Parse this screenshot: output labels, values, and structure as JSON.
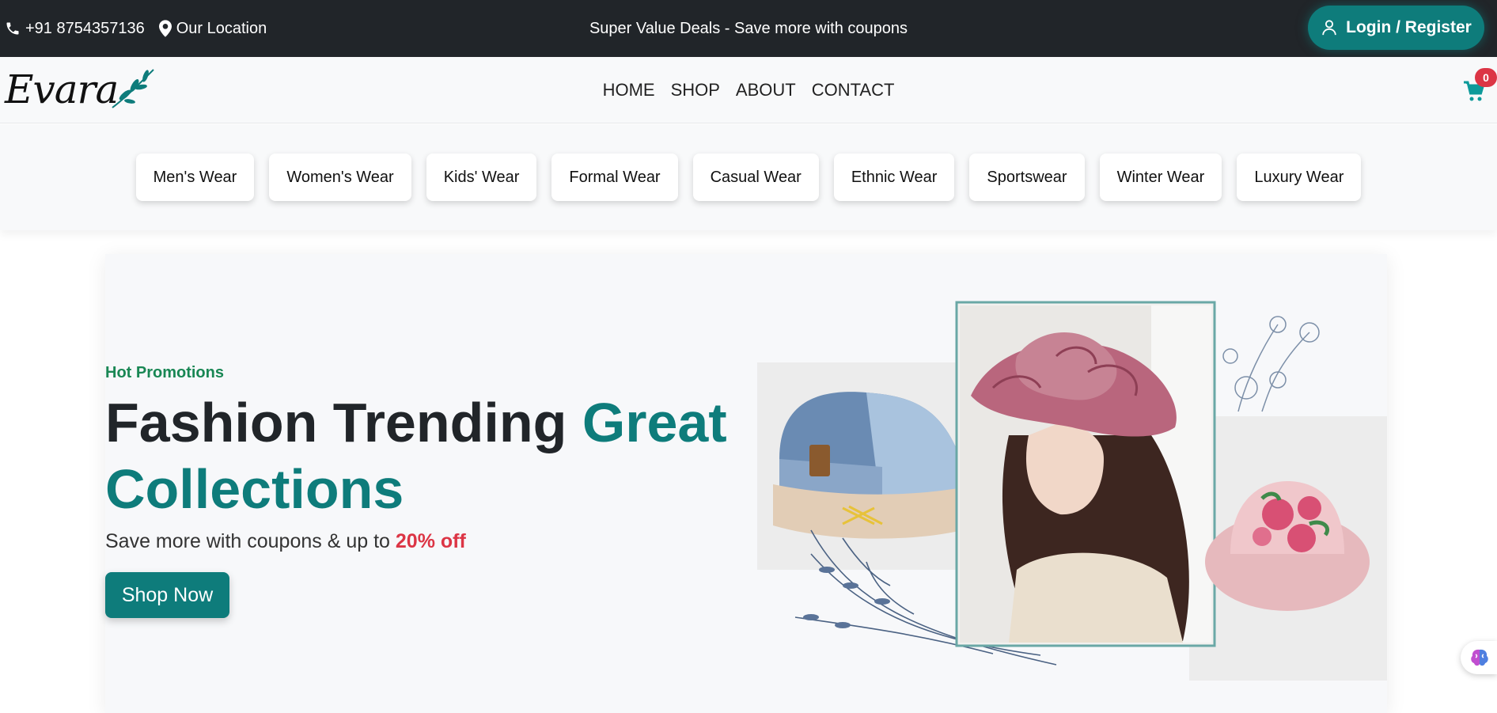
{
  "topbar": {
    "phone": "+91 8754357136",
    "location": "Our Location",
    "announcement": "Super Value Deals - Save more with coupons",
    "login_label": "Login / Register"
  },
  "navbar": {
    "logo_text": "Evara",
    "menu": [
      "HOME",
      "SHOP",
      "ABOUT",
      "CONTACT"
    ],
    "cart_count": "0"
  },
  "categories": [
    "Men's Wear",
    "Women's Wear",
    "Kids' Wear",
    "Formal Wear",
    "Casual Wear",
    "Ethnic Wear",
    "Sportswear",
    "Winter Wear",
    "Luxury Wear"
  ],
  "hero": {
    "eyebrow": "Hot Promotions",
    "headline_dark": "Fashion Trending",
    "headline_accent": "Great Collections",
    "subline": "Save more with coupons & up to",
    "discount": "20% off",
    "cta_label": "Shop Now"
  },
  "colors": {
    "brand": "#0e7c7b",
    "topbar_bg": "#212529",
    "promo_green": "#198754",
    "sale_red": "#dc3545"
  }
}
